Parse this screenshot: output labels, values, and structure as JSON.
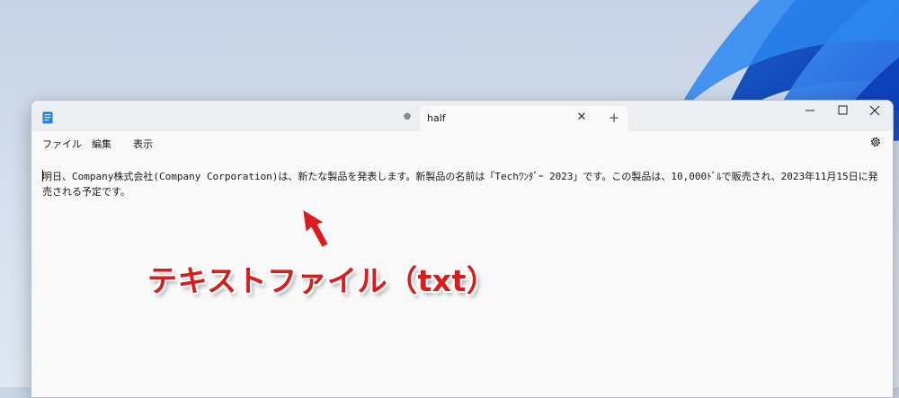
{
  "tab": {
    "title": "half"
  },
  "menu": {
    "file": "ファイル",
    "edit": "編集",
    "view": "表示"
  },
  "document": {
    "text": "明日、Company株式会社(Company Corporation)は、新たな製品を発表します。新製品の名前は「Techﾜﾝﾀﾞｰ 2023」です。この製品は、10,000ﾄﾞﾙで販売され、2023年11月15日に発売される予定です。"
  },
  "annotation": {
    "label": "テキストファイル（txt）",
    "color": "#e01a1a"
  },
  "icons": [
    "notepad-icon",
    "unsaved-dot-icon",
    "close-icon",
    "plus-icon",
    "minimize-icon",
    "maximize-icon",
    "close-window-icon",
    "gear-icon",
    "arrow-icon"
  ],
  "colors": {
    "accent": "#0f67c9",
    "annotation": "#e01a1a"
  }
}
